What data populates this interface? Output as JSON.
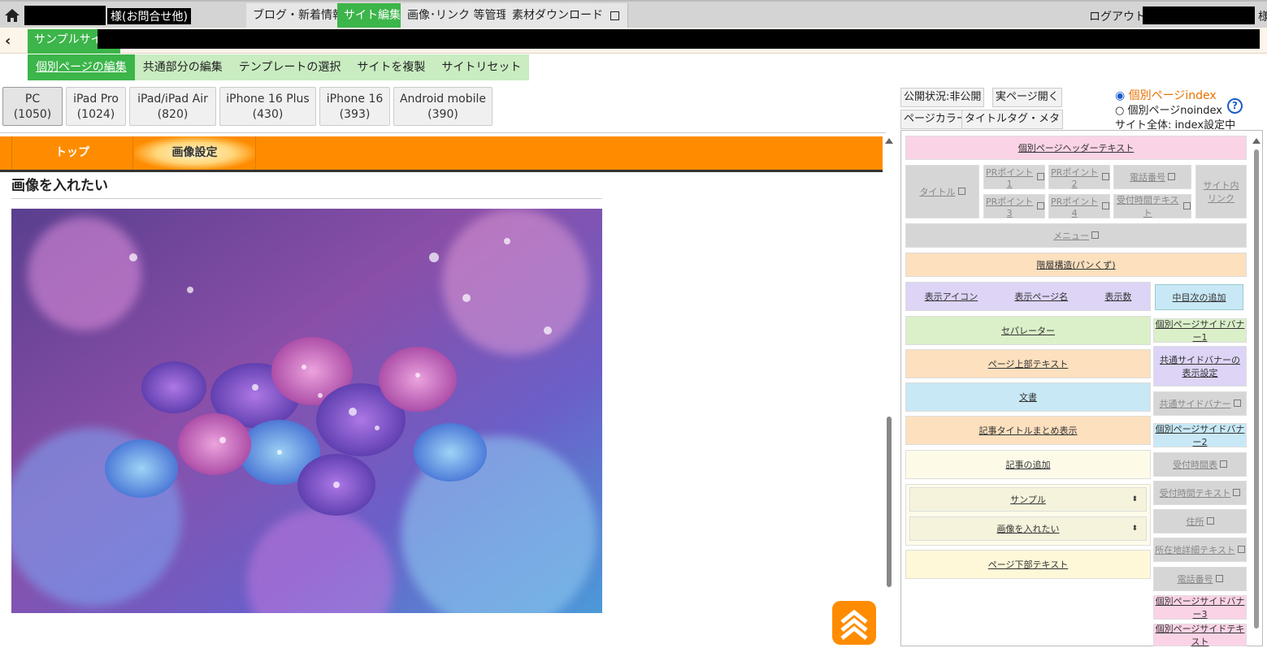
{
  "topbar": {
    "contact_label": "様(お問合せ他)",
    "nav": [
      {
        "label": "ブログ・新着情報",
        "active": false
      },
      {
        "label": "サイト編集",
        "active": true
      },
      {
        "label": "画像･リンク 等管理",
        "active": false
      },
      {
        "label": "素材ダウンロード",
        "active": false
      }
    ],
    "logout_label": "ログアウト(",
    "logout_suffix": "様"
  },
  "row2": {
    "back_icon": "chevron-left-icon",
    "site_label": "サンプルサイト"
  },
  "subnav": [
    {
      "label": "個別ページの編集",
      "active": true
    },
    {
      "label": "共通部分の編集",
      "active": false
    },
    {
      "label": "テンプレートの選択",
      "active": false
    },
    {
      "label": "サイトを複製",
      "active": false
    },
    {
      "label": "サイトリセット",
      "active": false
    }
  ],
  "devices": [
    {
      "name": "PC",
      "width": "(1050)",
      "active": true
    },
    {
      "name": "iPad Pro",
      "width": "(1024)",
      "active": false
    },
    {
      "name": "iPad/iPad Air",
      "width": "(820)",
      "active": false
    },
    {
      "name": "iPhone 16 Plus",
      "width": "(430)",
      "active": false
    },
    {
      "name": "iPhone 16",
      "width": "(393)",
      "active": false
    },
    {
      "name": "Android mobile",
      "width": "(390)",
      "active": false
    }
  ],
  "preview": {
    "nav": [
      {
        "label": "トップ"
      },
      {
        "label": "画像設定"
      }
    ],
    "heading": "画像を入れたい",
    "image_alt": "hydrangea-photo"
  },
  "rightpanel": {
    "publish_status": "公開状況:非公開",
    "open_page": "実ページ開く",
    "page_color": "ページカラー",
    "title_tag": "タイトルタグ・メタ",
    "radio_index": "個別ページindex",
    "radio_noindex": "個別ページnoindex",
    "site_index": "サイト全体: index設定中",
    "help_icon": "?",
    "blocks": {
      "header_text": "個別ページヘッダーテキスト",
      "title": "タイトル",
      "pr1": "PRポイント1",
      "pr2": "PRポイント2",
      "tel": "電話番号",
      "pr3": "PRポイント3",
      "pr4": "PRポイント4",
      "reception_text": "受付時間テキスト",
      "site_link": "サイト内リンク",
      "menu": "メニュー",
      "breadcrumb": "階層構造(パンくず)",
      "show_icon": "表示アイコン",
      "show_page_name": "表示ページ名",
      "show_count": "表示数",
      "toc_add": "中目次の追加",
      "separator": "セパレーター",
      "page_top_text": "ページ上部テキスト",
      "text": "文書",
      "article_title_summary": "記事タイトルまとめ表示",
      "article_add": "記事の追加",
      "select1": "サンプル",
      "select2": "画像を入れたい",
      "page_bottom_text": "ページ下部テキスト",
      "side_banner1": "個別ページサイドバナー1",
      "common_banner_setting": "共通サイドバナーの表示設定",
      "common_banner": "共通サイドバナー",
      "side_banner2": "個別ページサイドバナー2",
      "reception_table": "受付時間表",
      "reception_text2": "受付時間テキスト",
      "address": "住所",
      "location_text": "所在地詳細テキスト",
      "tel2": "電話番号",
      "side_banner3": "個別ページサイドバナー3",
      "side_text": "個別ページサイドテキスト"
    }
  },
  "colors": {
    "accent_green": "#3cb54a",
    "orange": "#ff8c00",
    "blue_link": "#1a5cc8",
    "orange_text": "#e87000"
  }
}
